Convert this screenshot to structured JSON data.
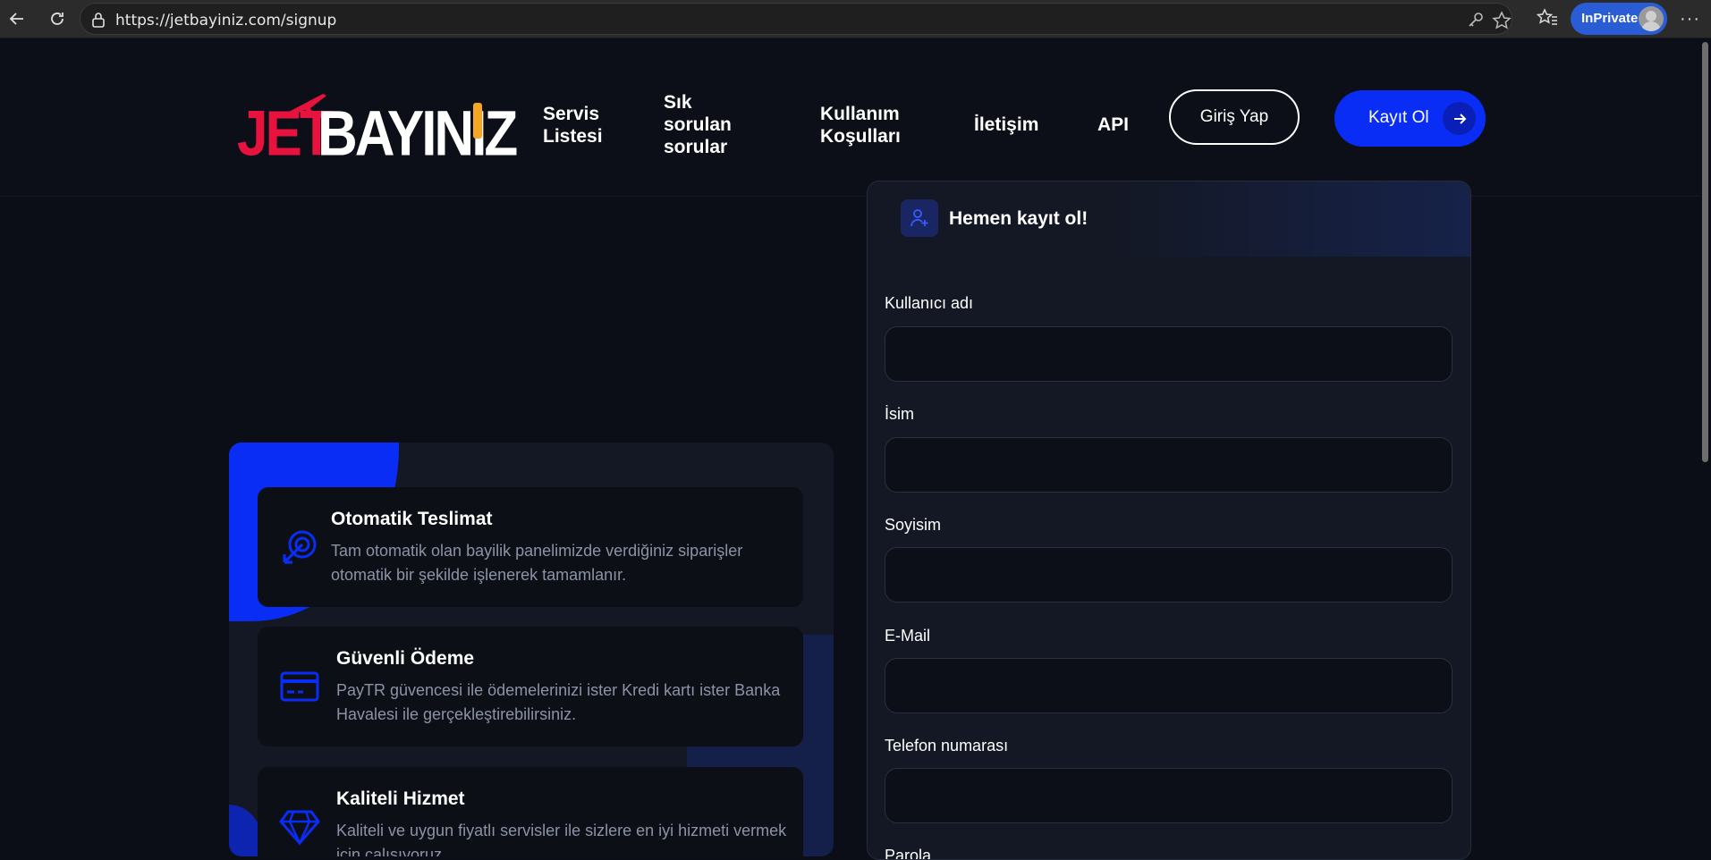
{
  "browser": {
    "url": "https://jetbayiniz.com/signup",
    "inprivate_label": "InPrivate",
    "icons": [
      "back-arrow-icon",
      "refresh-icon",
      "lock-icon",
      "key-icon",
      "star-icon",
      "favorites-icon",
      "more-icon"
    ]
  },
  "header": {
    "logo_part1": "JET",
    "logo_part2": "BAYINIZ",
    "nav": [
      {
        "label": "Servis Listesi"
      },
      {
        "label": "Sık sorulan sorular"
      },
      {
        "label": "Kullanım Koşulları"
      },
      {
        "label": "İletişim"
      },
      {
        "label": "API"
      }
    ],
    "login_label": "Giriş Yap",
    "register_label": "Kayıt Ol",
    "accent_color": "#0a2df5"
  },
  "features": [
    {
      "title": "Otomatik Teslimat",
      "desc": "Tam otomatik olan bayilik panelimizde verdiğiniz siparişler otomatik bir şekilde işlenerek tamamlanır.",
      "icon": "target-cursor-icon"
    },
    {
      "title": "Güvenli Ödeme",
      "desc": "PayTR güvencesi ile ödemelerinizi ister Kredi kartı ister Banka Havalesi ile gerçekleştirebilirsiniz.",
      "icon": "credit-card-icon"
    },
    {
      "title": "Kaliteli Hizmet",
      "desc": "Kaliteli ve uygun fiyatlı servisler ile sizlere en iyi hizmeti vermek için çalışıyoruz.",
      "icon": "diamond-icon"
    }
  ],
  "form": {
    "title": "Hemen kayıt ol!",
    "fields": [
      {
        "label": "Kullanıcı adı",
        "value": ""
      },
      {
        "label": "İsim",
        "value": ""
      },
      {
        "label": "Soyisim",
        "value": ""
      },
      {
        "label": "E-Mail",
        "value": ""
      },
      {
        "label": "Telefon numarası",
        "value": ""
      },
      {
        "label": "Parola",
        "value": ""
      }
    ]
  }
}
